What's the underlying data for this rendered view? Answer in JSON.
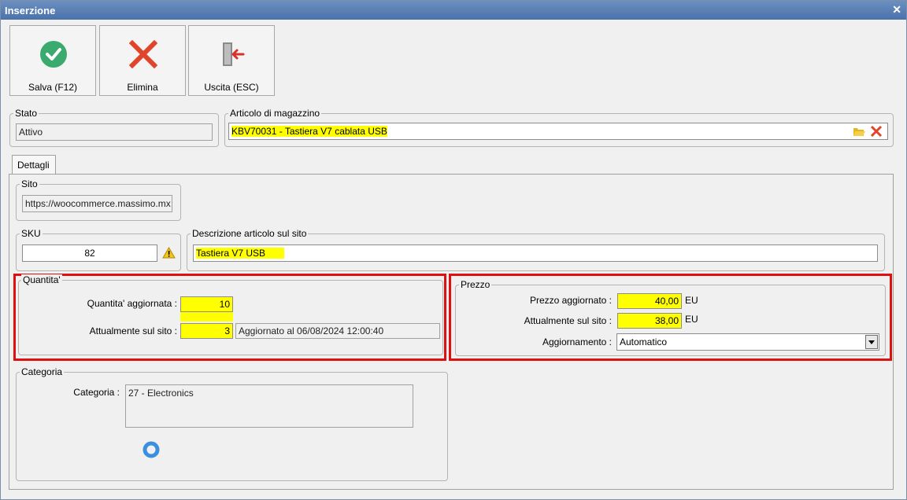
{
  "window": {
    "title": "Inserzione"
  },
  "toolbar": {
    "save_label": "Salva (F12)",
    "delete_label": "Elimina",
    "exit_label": "Uscita (ESC)"
  },
  "stato": {
    "legend": "Stato",
    "value": "Attivo"
  },
  "articolo": {
    "legend": "Articolo di magazzino",
    "value": "KBV70031 - Tastiera V7 cablata USB"
  },
  "tabs": [
    {
      "label": "Dettagli"
    }
  ],
  "sito": {
    "legend": "Sito",
    "value": "https://woocommerce.massimo.mx"
  },
  "sku": {
    "legend": "SKU",
    "value": "82"
  },
  "descrizione": {
    "legend": "Descrizione articolo sul sito",
    "value": "Tastiera V7 USB"
  },
  "quantita": {
    "legend": "Quantita'",
    "updated_label": "Quantita' aggiornata :",
    "updated_value": "10",
    "current_label": "Attualmente sul sito :",
    "current_value": "3",
    "updated_at": "Aggiornato al 06/08/2024 12:00:40"
  },
  "prezzo": {
    "legend": "Prezzo",
    "updated_label": "Prezzo aggiornato :",
    "updated_value": "40,00",
    "current_label": "Attualmente sul sito :",
    "current_value": "38,00",
    "currency": "EU",
    "mode_label": "Aggiornamento :",
    "mode_value": "Automatico"
  },
  "categoria": {
    "legend": "Categoria",
    "label": "Categoria :",
    "value": "27 - Electronics"
  },
  "colors": {
    "highlight": "#ffff00",
    "emphasis_border": "#e01010",
    "save_icon": "#3aaa6e",
    "delete_icon": "#e0452b",
    "spinner": "#3b8fe0"
  },
  "icons": [
    "check-circle-icon",
    "x-icon",
    "exit-door-icon",
    "folder-open-icon",
    "clear-x-icon",
    "warning-icon",
    "dropdown-arrow-icon",
    "loading-spinner-icon",
    "close-icon"
  ]
}
